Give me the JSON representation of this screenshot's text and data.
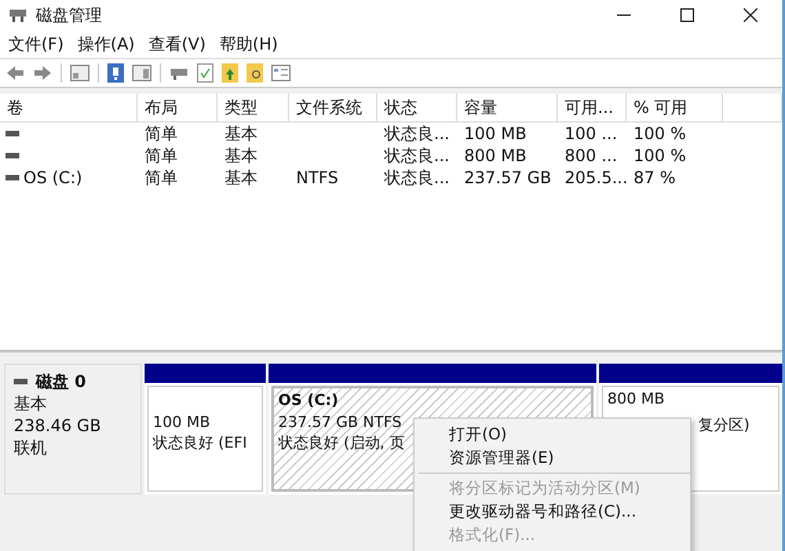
{
  "window": {
    "title": "磁盘管理"
  },
  "menu": [
    "文件(F)",
    "操作(A)",
    "查看(V)",
    "帮助(H)"
  ],
  "table": {
    "columns": [
      "卷",
      "布局",
      "类型",
      "文件系统",
      "状态",
      "容量",
      "可用...",
      "% 可用"
    ],
    "rows": [
      {
        "cells": [
          "",
          "简单",
          "基本",
          "",
          "状态良...",
          "100 MB",
          "100 ...",
          "100 %"
        ]
      },
      {
        "cells": [
          "",
          "简单",
          "基本",
          "",
          "状态良...",
          "800 MB",
          "800 ...",
          "100 %"
        ]
      },
      {
        "cells": [
          "OS (C:)",
          "简单",
          "基本",
          "NTFS",
          "状态良...",
          "237.57 GB",
          "205.5...",
          "87 %"
        ]
      }
    ]
  },
  "disk": {
    "name": "磁盘 0",
    "type": "基本",
    "size": "238.46 GB",
    "status": "联机"
  },
  "partitions": [
    {
      "size": "100 MB",
      "status": "状态良好 (EFI",
      "hatched": false
    },
    {
      "name": "OS  (C:)",
      "size": "237.57 GB NTFS",
      "status": "状态良好 (启动, 页",
      "hatched": true
    },
    {
      "size": "800 MB",
      "status": "复分区)",
      "hatched": false
    }
  ],
  "context_menu": [
    {
      "kind": "item",
      "label": "打开(O)",
      "disabled": false
    },
    {
      "kind": "item",
      "label": "资源管理器(E)",
      "disabled": false
    },
    {
      "kind": "separator"
    },
    {
      "kind": "item",
      "label": "将分区标记为活动分区(M)",
      "disabled": true
    },
    {
      "kind": "item",
      "label": "更改驱动器号和路径(C)...",
      "disabled": false
    },
    {
      "kind": "item",
      "label": "格式化(F)...",
      "disabled": true
    }
  ]
}
